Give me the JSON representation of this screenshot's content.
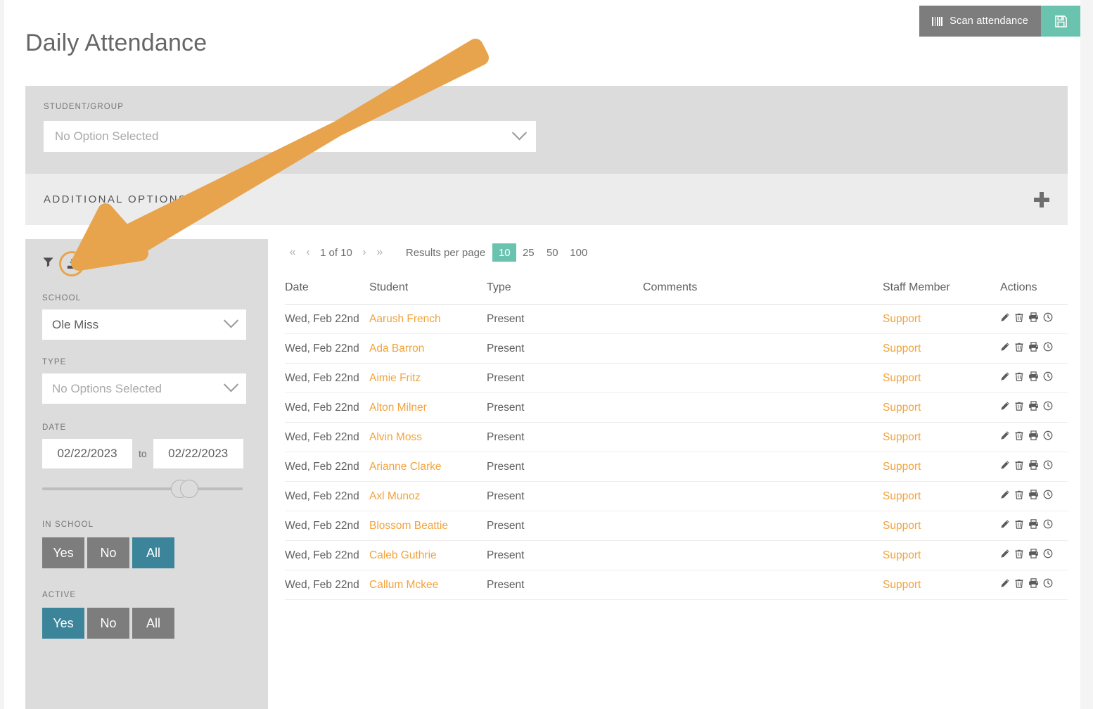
{
  "topbar": {
    "scan_label": "Scan attendance",
    "scan_icon": "barcode-icon",
    "save_icon": "floppy-disk-save-icon",
    "scan_bg": "#7d7d7d",
    "save_bg": "#6ac3ae"
  },
  "page": {
    "title": "Daily Attendance"
  },
  "student_group": {
    "label": "STUDENT/GROUP",
    "placeholder": "No Option Selected",
    "chevron_icon": "chevron-down-icon"
  },
  "additional_options": {
    "label": "ADDITIONAL OPTIONS",
    "expand_icon": "plus-icon"
  },
  "sidebar": {
    "filter_icon": "filter-funnel-icon",
    "download_icon": "download-icon",
    "school": {
      "label": "SCHOOL",
      "value": "Ole Miss",
      "chevron_icon": "chevron-down-icon"
    },
    "type": {
      "label": "TYPE",
      "placeholder": "No Options Selected",
      "chevron_icon": "chevron-down-icon"
    },
    "date": {
      "label": "DATE",
      "from": "02/22/2023",
      "to_label": "to",
      "to": "02/22/2023"
    },
    "in_school": {
      "label": "IN SCHOOL",
      "options": [
        "Yes",
        "No",
        "All"
      ],
      "selected": "All"
    },
    "active": {
      "label": "ACTIVE",
      "options": [
        "Yes",
        "No",
        "All"
      ],
      "selected": "Yes"
    },
    "colors": {
      "active_toggle": "#3b8499",
      "inactive_toggle": "#7d7d7d",
      "panel_bg": "#dcdcdc"
    }
  },
  "pagination": {
    "first_icon": "«",
    "prev_icon": "‹",
    "page_text": "1 of 10",
    "next_icon": "›",
    "last_icon": "»",
    "results_per_page_label": "Results per page",
    "options": [
      "10",
      "25",
      "50",
      "100"
    ],
    "selected": "10",
    "highlight_color": "#6ac3ae"
  },
  "table": {
    "columns": [
      "Date",
      "Student",
      "Type",
      "Comments",
      "Staff Member",
      "Actions"
    ],
    "action_icons": [
      "pencil-edit-icon",
      "trash-delete-icon",
      "printer-print-icon",
      "clock-history-icon"
    ],
    "link_color": "#f2a33c",
    "rows": [
      {
        "date": "Wed, Feb 22nd",
        "student": "Aarush French",
        "type": "Present",
        "comments": "",
        "staff": "Support"
      },
      {
        "date": "Wed, Feb 22nd",
        "student": "Ada Barron",
        "type": "Present",
        "comments": "",
        "staff": "Support"
      },
      {
        "date": "Wed, Feb 22nd",
        "student": "Aimie Fritz",
        "type": "Present",
        "comments": "",
        "staff": "Support"
      },
      {
        "date": "Wed, Feb 22nd",
        "student": "Alton Milner",
        "type": "Present",
        "comments": "",
        "staff": "Support"
      },
      {
        "date": "Wed, Feb 22nd",
        "student": "Alvin Moss",
        "type": "Present",
        "comments": "",
        "staff": "Support"
      },
      {
        "date": "Wed, Feb 22nd",
        "student": "Arianne Clarke",
        "type": "Present",
        "comments": "",
        "staff": "Support"
      },
      {
        "date": "Wed, Feb 22nd",
        "student": "Axl Munoz",
        "type": "Present",
        "comments": "",
        "staff": "Support"
      },
      {
        "date": "Wed, Feb 22nd",
        "student": "Blossom Beattie",
        "type": "Present",
        "comments": "",
        "staff": "Support"
      },
      {
        "date": "Wed, Feb 22nd",
        "student": "Caleb Guthrie",
        "type": "Present",
        "comments": "",
        "staff": "Support"
      },
      {
        "date": "Wed, Feb 22nd",
        "student": "Callum Mckee",
        "type": "Present",
        "comments": "",
        "staff": "Support"
      }
    ]
  },
  "annotation": {
    "type": "arrow",
    "color": "#e8a44c",
    "points_to": "download-icon"
  }
}
